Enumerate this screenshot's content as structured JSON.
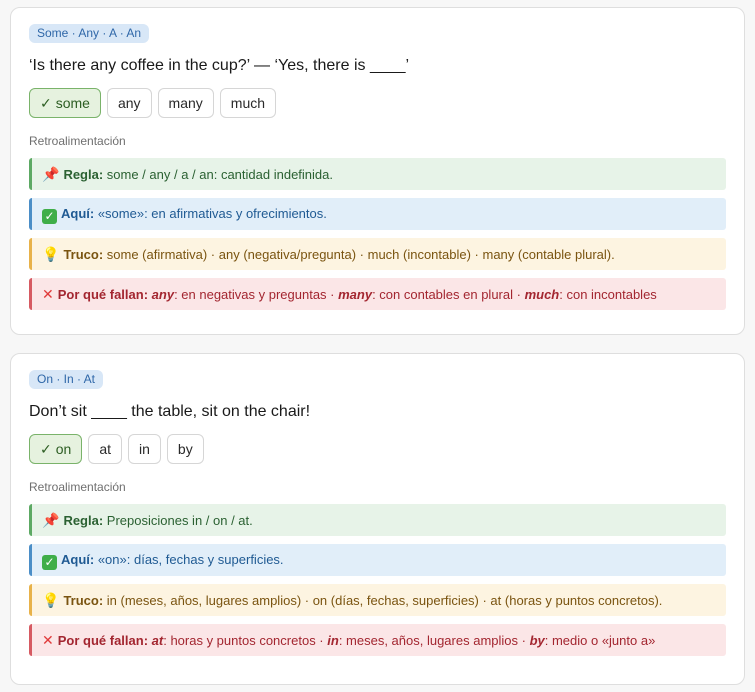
{
  "cards": [
    {
      "tag": "Some · Any · A · An",
      "question": "‘Is there any coffee in the cup?’ — ‘Yes, there is ____’",
      "options": [
        {
          "label": "some",
          "correct": true
        },
        {
          "label": "any",
          "correct": false
        },
        {
          "label": "many",
          "correct": false
        },
        {
          "label": "much",
          "correct": false
        }
      ],
      "feedback_label": "Retroalimentación",
      "rule": {
        "icon": "pushpin-icon",
        "title": "Regla:",
        "text": " some / any / a / an: cantidad indefinida."
      },
      "here": {
        "icon": "check-box-icon",
        "title": "Aquí:",
        "text": " «some»: en afirmativas y ofrecimientos."
      },
      "tip": {
        "icon": "lightbulb-icon",
        "title": "Truco:",
        "text": " some (afirmativa) · any (negativa/pregunta) · much (incontable) · many (contable plural)."
      },
      "why": {
        "icon": "cross-icon",
        "title": "Por qué fallan:",
        "parts": [
          {
            "word": "any",
            "text": ": en negativas y preguntas · "
          },
          {
            "word": "many",
            "text": ": con contables en plural · "
          },
          {
            "word": "much",
            "text": ": con incontables"
          }
        ]
      }
    },
    {
      "tag": "On · In · At",
      "question": "Don’t sit ____ the table, sit on the chair!",
      "options": [
        {
          "label": "on",
          "correct": true
        },
        {
          "label": "at",
          "correct": false
        },
        {
          "label": "in",
          "correct": false
        },
        {
          "label": "by",
          "correct": false
        }
      ],
      "feedback_label": "Retroalimentación",
      "rule": {
        "icon": "pushpin-icon",
        "title": "Regla:",
        "text": " Preposiciones in / on / at."
      },
      "here": {
        "icon": "check-box-icon",
        "title": "Aquí:",
        "text": " «on»: días, fechas y superficies."
      },
      "tip": {
        "icon": "lightbulb-icon",
        "title": "Truco:",
        "text": " in (meses, años, lugares amplios) · on (días, fechas, superficies) · at (horas y puntos concretos)."
      },
      "why": {
        "icon": "cross-icon",
        "title": "Por qué fallan:",
        "parts": [
          {
            "word": "at",
            "text": ": horas y puntos concretos · "
          },
          {
            "word": "in",
            "text": ": meses, años, lugares amplios · "
          },
          {
            "word": "by",
            "text": ": medio o «junto a»"
          }
        ]
      }
    }
  ],
  "check_mark": "✓",
  "colors": {
    "correct_bg": "#e6f2df",
    "rule": "#5da964",
    "here": "#4b8ec7",
    "tip": "#e8b24a",
    "why": "#d65a62"
  }
}
